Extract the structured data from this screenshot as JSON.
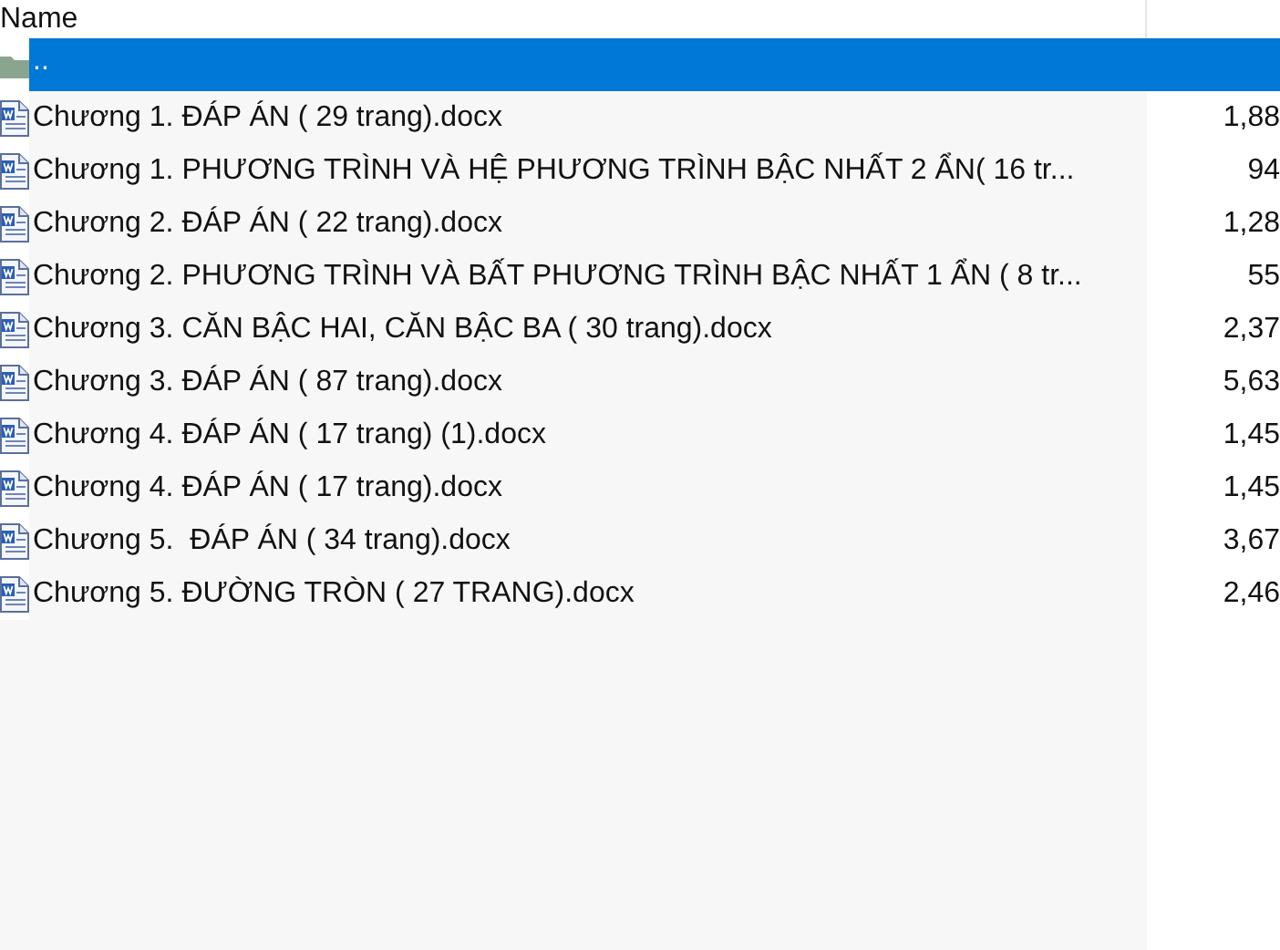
{
  "columns": [
    {
      "label": "Name"
    }
  ],
  "rows": [
    {
      "kind": "folder",
      "name": "..",
      "selected": true
    },
    {
      "kind": "docx",
      "name": "Chương 1. ĐÁP ÁN ( 29 trang).docx",
      "size": "1,88",
      "selected": false
    },
    {
      "kind": "docx",
      "name": "Chương 1. PHƯƠNG TRÌNH VÀ HỆ PHƯƠNG TRÌNH BẬC NHẤT 2 ẨN( 16 tr...",
      "size": "94",
      "selected": false
    },
    {
      "kind": "docx",
      "name": "Chương 2. ĐÁP ÁN ( 22 trang).docx",
      "size": "1,28",
      "selected": false
    },
    {
      "kind": "docx",
      "name": "Chương 2. PHƯƠNG TRÌNH VÀ BẤT PHƯƠNG TRÌNH BẬC NHẤT 1 ẨN ( 8 tr...",
      "size": "55",
      "selected": false
    },
    {
      "kind": "docx",
      "name": "Chương 3. CĂN BẬC HAI, CĂN BẬC BA ( 30 trang).docx",
      "size": "2,37",
      "selected": false
    },
    {
      "kind": "docx",
      "name": "Chương 3. ĐÁP ÁN ( 87 trang).docx",
      "size": "5,63",
      "selected": false
    },
    {
      "kind": "docx",
      "name": "Chương 4. ĐÁP ÁN ( 17 trang) (1).docx",
      "size": "1,45",
      "selected": false
    },
    {
      "kind": "docx",
      "name": "Chương 4. ĐÁP ÁN ( 17 trang).docx",
      "size": "1,45",
      "selected": false
    },
    {
      "kind": "docx",
      "name": "Chương 5.  ĐÁP ÁN ( 34 trang).docx",
      "size": "3,67",
      "selected": false
    },
    {
      "kind": "docx",
      "name": "Chương 5. ĐƯỜNG TRÒN ( 27 TRANG).docx",
      "size": "2,46",
      "selected": false
    }
  ]
}
